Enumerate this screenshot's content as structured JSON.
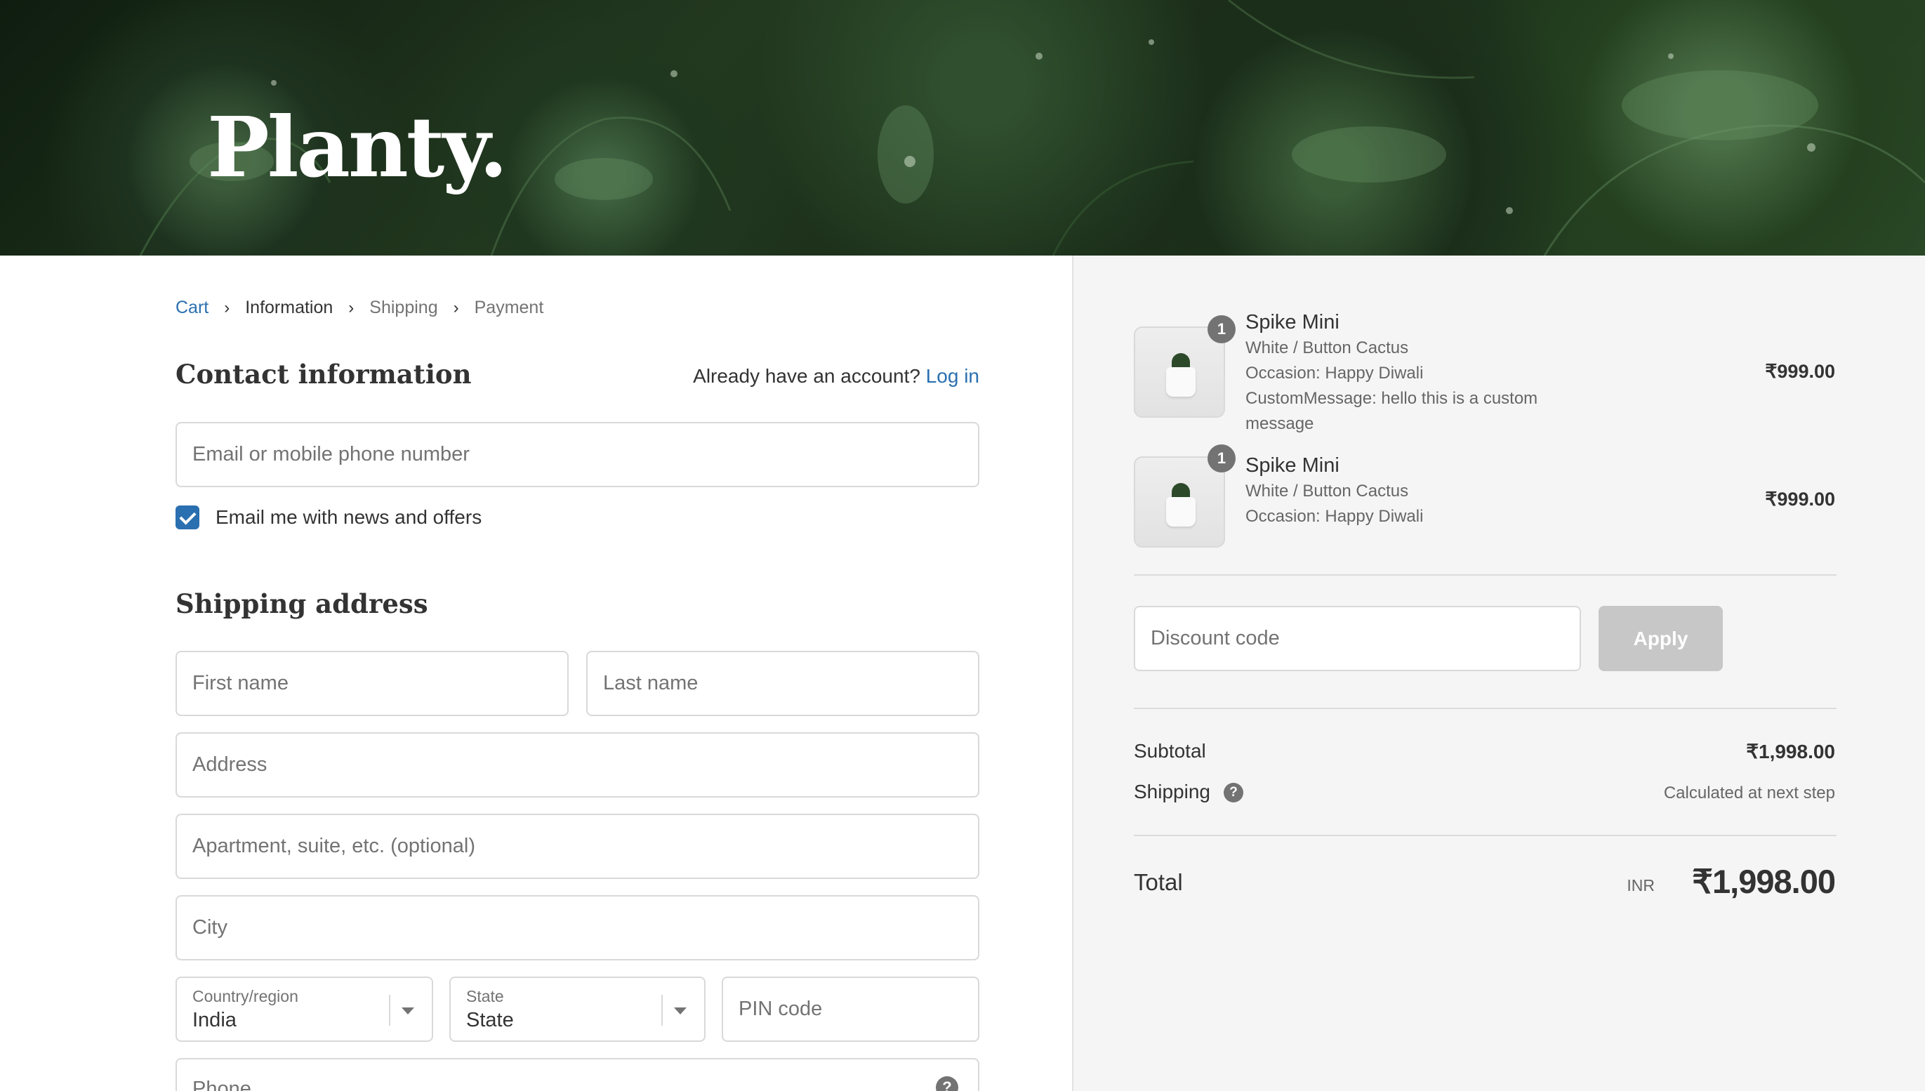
{
  "brand": {
    "logo_text": "Planty."
  },
  "breadcrumb": [
    {
      "label": "Cart"
    },
    {
      "label": "Information"
    },
    {
      "label": "Shipping"
    },
    {
      "label": "Payment"
    }
  ],
  "contact": {
    "title": "Contact information",
    "account_prompt": "Already have an account?",
    "login_label": "Log in",
    "email_placeholder": "Email or mobile phone number",
    "newsletter_label": "Email me with news and offers",
    "newsletter_checked": true
  },
  "shipping": {
    "title": "Shipping address",
    "first_name_placeholder": "First name",
    "last_name_placeholder": "Last name",
    "address_placeholder": "Address",
    "apartment_placeholder": "Apartment, suite, etc. (optional)",
    "city_placeholder": "City",
    "country_label": "Country/region",
    "country_value": "India",
    "state_label": "State",
    "state_value": "State",
    "pin_placeholder": "PIN code",
    "phone_placeholder": "Phone"
  },
  "order": {
    "items": [
      {
        "quantity": "1",
        "title": "Spike Mini",
        "variant": "White / Button Cactus",
        "occasion": "Occasion: Happy Diwali",
        "custom_message_line1": "CustomMessage: hello this is a custom",
        "custom_message_line2": "message",
        "price": "₹999.00"
      },
      {
        "quantity": "1",
        "title": "Spike Mini",
        "variant": "White / Button Cactus",
        "occasion": "Occasion: Happy Diwali",
        "price": "₹999.00"
      }
    ],
    "discount_placeholder": "Discount code",
    "apply_label": "Apply",
    "subtotal_label": "Subtotal",
    "subtotal_value": "₹1,998.00",
    "shipping_label": "Shipping",
    "shipping_value": "Calculated at next step",
    "total_label": "Total",
    "currency_code": "INR",
    "total_value": "₹1,998.00"
  },
  "colors": {
    "link": "#2a6fb0",
    "sidebar_bg": "#f5f5f5",
    "apply_disabled": "#c7c7c7"
  }
}
